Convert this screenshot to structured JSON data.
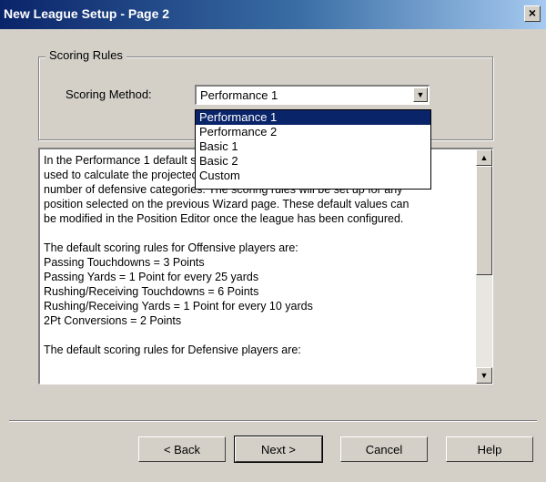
{
  "window": {
    "title": "New League Setup - Page 2",
    "close_label": "×"
  },
  "scoring": {
    "group_title": "Scoring Rules",
    "method_label": "Scoring Method:",
    "selected": "Performance 1",
    "options": [
      "Performance 1",
      "Performance 2",
      "Basic 1",
      "Basic 2",
      "Custom"
    ]
  },
  "description": {
    "lines": [
      "In the Performance 1 default scoring rules there are",
      "used to calculate the projected points as well as a",
      "number of defensive categories. The scoring rules will be set up for any",
      "position selected on the previous Wizard page. These default values can",
      "be modified in the Position Editor once the league has been configured.",
      "",
      "The default scoring rules for Offensive players are:",
      "Passing Touchdowns = 3 Points",
      "Passing Yards = 1 Point for every 25 yards",
      "Rushing/Receiving Touchdowns = 6 Points",
      "Rushing/Receiving Yards = 1 Point for every 10 yards",
      "2Pt Conversions = 2 Points",
      "",
      "The default scoring rules for Defensive players are:"
    ]
  },
  "buttons": {
    "back": "< Back",
    "next": "Next >",
    "cancel": "Cancel",
    "help": "Help"
  }
}
